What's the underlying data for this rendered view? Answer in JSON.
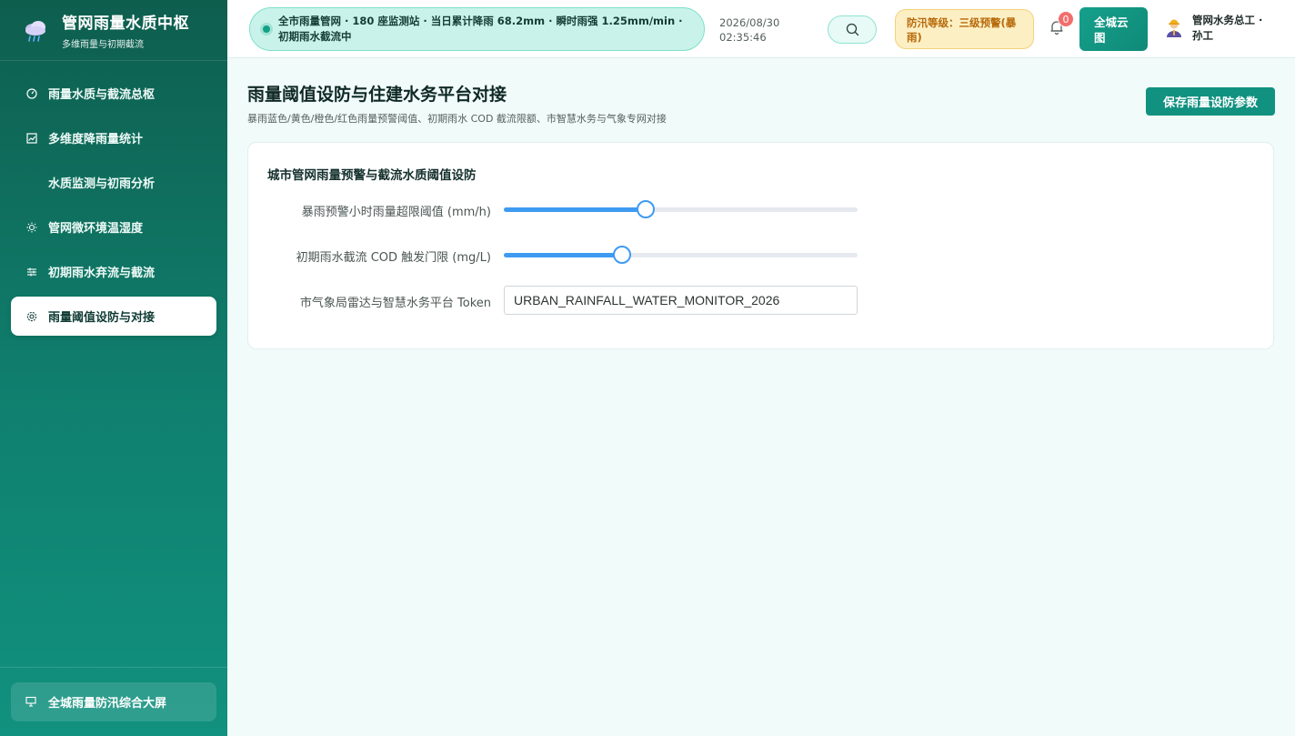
{
  "brand": {
    "title": "管网雨量水质中枢",
    "subtitle": "多维雨量与初期截流",
    "logo_icon": "rain-cloud-icon"
  },
  "sidebar": {
    "items": [
      {
        "label": "雨量水质与截流总枢",
        "icon": "gauge-icon",
        "active": false
      },
      {
        "label": "多维度降雨量统计",
        "icon": "chart-icon",
        "active": false
      },
      {
        "label": "水质监测与初雨分析",
        "icon": "",
        "active": false
      },
      {
        "label": "管网微环境温湿度",
        "icon": "sun-icon",
        "active": false
      },
      {
        "label": "初期雨水弃流与截流",
        "icon": "sliders-icon",
        "active": false
      },
      {
        "label": "雨量阈值设防与对接",
        "icon": "gear-icon",
        "active": true
      }
    ],
    "footer_label": "全城雨量防汛综合大屏"
  },
  "header": {
    "ticker": "全市雨量管网 · 180 座监测站 · 当日累计降雨 68.2mm · 瞬时雨强 1.25mm/min · 初期雨水截流中",
    "date": "2026/08/30",
    "time": "02:35:46",
    "alert": "防汛等级：三级预警(暴雨)",
    "notification_count": "0",
    "map_button": "全城云图",
    "user_name": "管网水务总工 · 孙工"
  },
  "page": {
    "title": "雨量阈值设防与住建水务平台对接",
    "subtitle": "暴雨蓝色/黄色/橙色/红色雨量预警阈值、初期雨水 COD 截流限额、市智慧水务与气象专网对接",
    "save_button": "保存雨量设防参数"
  },
  "form": {
    "card_title": "城市管网雨量预警与截流水质阈值设防",
    "rain_threshold": {
      "label": "暴雨预警小时雨量超限阈值 (mm/h)",
      "fraction": 0.4
    },
    "cod_threshold": {
      "label": "初期雨水截流 COD 触发门限 (mg/L)",
      "fraction": 0.333
    },
    "token": {
      "label": "市气象局雷达与智慧水务平台 Token",
      "value": "URBAN_RAINFALL_WATER_MONITOR_2026"
    }
  },
  "colors": {
    "sidebar": "#0e5e4e",
    "accent": "#11917f",
    "slider": "#3f9bf2",
    "alert_bg": "#fdefc4",
    "alert_text": "#b76a0a"
  }
}
